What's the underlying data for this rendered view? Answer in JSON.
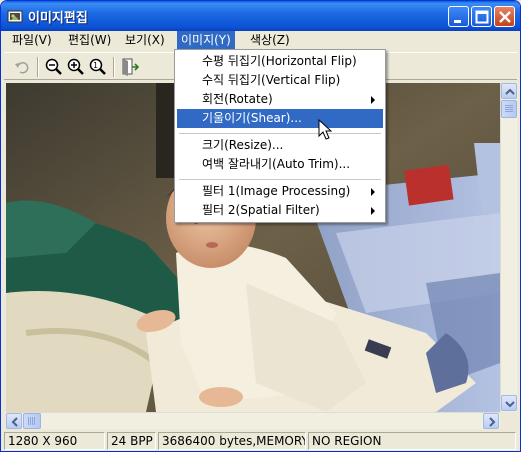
{
  "window": {
    "title": "이미지편집",
    "icons": {
      "app": "image-edit-app-icon",
      "minimize": "minimize-icon",
      "maximize": "maximize-icon",
      "close": "close-icon"
    }
  },
  "menubar": {
    "items": [
      "파일(V)",
      "편집(W)",
      "보기(X)",
      "이미지(Y)",
      "색상(Z)"
    ],
    "active": "이미지(Y)"
  },
  "toolbar": {
    "tools": [
      "undo-icon",
      "zoom-out-icon",
      "zoom-in-icon",
      "zoom-fit-icon",
      "exit-icon"
    ]
  },
  "image_menu": {
    "items": [
      {
        "label": "수평 뒤집기(Horizontal Flip)",
        "submenu": false
      },
      {
        "label": "수직 뒤집기(Vertical Flip)",
        "submenu": false
      },
      {
        "label": "회전(Rotate)",
        "submenu": true
      },
      {
        "label": "기울이기(Shear)...",
        "submenu": false,
        "highlighted": true
      },
      {
        "label": "크기(Resize)...",
        "submenu": false
      },
      {
        "label": "여백 잘라내기(Auto Trim)...",
        "submenu": false
      },
      {
        "label": "필터 1(Image Processing)",
        "submenu": true
      },
      {
        "label": "필터 2(Spatial Filter)",
        "submenu": true
      }
    ]
  },
  "statusbar": {
    "dimensions": "1280 X 960",
    "bpp": "24 BPP",
    "memory": "3686400 bytes,MEMORY",
    "region": "NO REGION"
  },
  "colors": {
    "title_bar": "#1d6ae3",
    "highlight": "#316ac5",
    "chrome": "#ece9d8"
  }
}
